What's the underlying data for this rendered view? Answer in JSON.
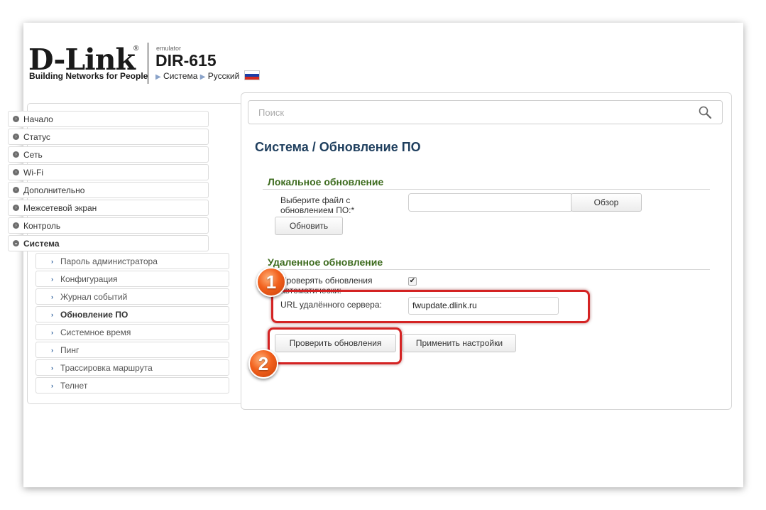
{
  "header": {
    "logo_text": "D-Link",
    "logo_reg": "®",
    "logo_tagline": "Building Networks for People",
    "emulator_label": "emulator",
    "model": "DIR-615",
    "nav_system": "Система",
    "nav_language": "Русский"
  },
  "sidebar": {
    "items": [
      {
        "label": "Начало"
      },
      {
        "label": "Статус"
      },
      {
        "label": "Сеть"
      },
      {
        "label": "Wi-Fi"
      },
      {
        "label": "Дополнительно"
      },
      {
        "label": "Межсетевой экран"
      },
      {
        "label": "Контроль"
      },
      {
        "label": "Система",
        "expanded": true
      }
    ],
    "subitems": [
      {
        "label": "Пароль администратора"
      },
      {
        "label": "Конфигурация"
      },
      {
        "label": "Журнал событий"
      },
      {
        "label": "Обновление ПО",
        "active": true
      },
      {
        "label": "Системное время"
      },
      {
        "label": "Пинг"
      },
      {
        "label": "Трассировка маршрута"
      },
      {
        "label": "Телнет"
      }
    ]
  },
  "search": {
    "placeholder": "Поиск"
  },
  "main": {
    "title": "Система /  Обновление ПО",
    "local": {
      "title": "Локальное обновление",
      "file_label_1": "Выберите файл с",
      "file_label_2": "обновлением ПО:*",
      "browse_button": "Обзор",
      "update_button": "Обновить"
    },
    "remote": {
      "title": "Удаленное обновление",
      "auto_label_1": "Проверять обновления",
      "auto_label_2": "автоматически:",
      "auto_checked": true,
      "url_label": "URL удалённого сервера:",
      "url_value": "fwupdate.dlink.ru",
      "check_button": "Проверить обновления",
      "apply_button": "Применить настройки"
    }
  },
  "annotations": {
    "badge_1": "1",
    "badge_2": "2",
    "color": "#d42323"
  }
}
